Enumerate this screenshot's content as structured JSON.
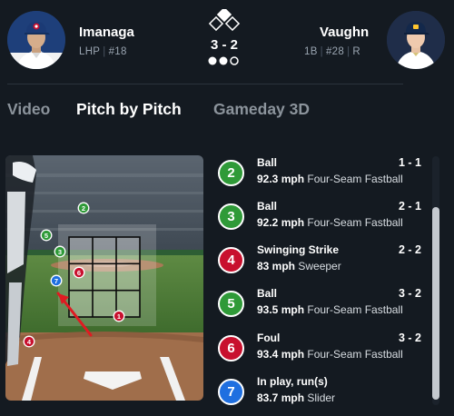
{
  "pitcher": {
    "name": "Imanaga",
    "position": "LHP",
    "number": "#18"
  },
  "batter": {
    "name": "Vaughn",
    "position": "1B",
    "number": "#28",
    "bats": "R"
  },
  "game_state": {
    "count": "3 - 2",
    "outs": 2,
    "runners": [
      "second"
    ]
  },
  "tabs": [
    {
      "label": "Video",
      "active": false
    },
    {
      "label": "Pitch by Pitch",
      "active": true
    },
    {
      "label": "Gameday 3D",
      "active": false
    }
  ],
  "colors": {
    "ball": "#2f9a38",
    "strike": "#c8102e",
    "in_play": "#1f6fe0",
    "background": "#141a21"
  },
  "zone_markers": [
    {
      "num": "1",
      "type": "strike"
    },
    {
      "num": "2",
      "type": "ball"
    },
    {
      "num": "3",
      "type": "ball"
    },
    {
      "num": "4",
      "type": "strike"
    },
    {
      "num": "5",
      "type": "ball"
    },
    {
      "num": "6",
      "type": "strike"
    },
    {
      "num": "7",
      "type": "in_play"
    }
  ],
  "pitches": [
    {
      "num": "2",
      "type": "ball",
      "result": "Ball",
      "count": "1 - 1",
      "speed": "92.3 mph",
      "pitch": "Four-Seam Fastball"
    },
    {
      "num": "3",
      "type": "ball",
      "result": "Ball",
      "count": "2 - 1",
      "speed": "92.2 mph",
      "pitch": "Four-Seam Fastball"
    },
    {
      "num": "4",
      "type": "strike",
      "result": "Swinging Strike",
      "count": "2 - 2",
      "speed": "83 mph",
      "pitch": "Sweeper"
    },
    {
      "num": "5",
      "type": "ball",
      "result": "Ball",
      "count": "3 - 2",
      "speed": "93.5 mph",
      "pitch": "Four-Seam Fastball"
    },
    {
      "num": "6",
      "type": "strike",
      "result": "Foul",
      "count": "3 - 2",
      "speed": "93.4 mph",
      "pitch": "Four-Seam Fastball"
    },
    {
      "num": "7",
      "type": "in_play",
      "result": "In play, run(s)",
      "count": "",
      "speed": "83.7 mph",
      "pitch": "Slider"
    }
  ]
}
